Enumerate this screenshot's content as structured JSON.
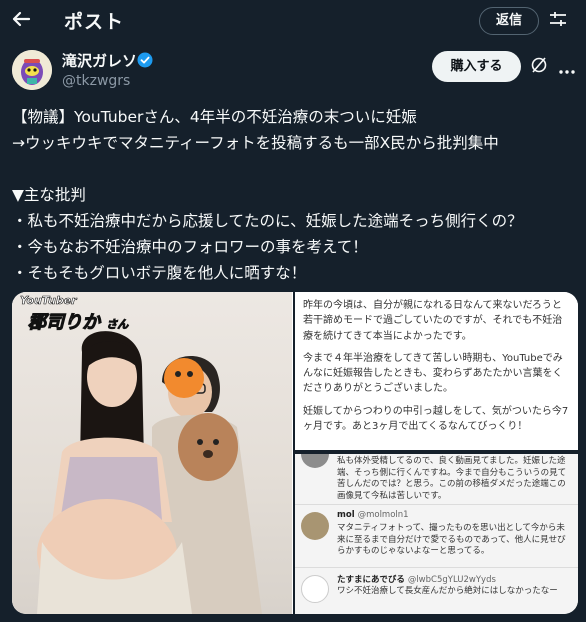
{
  "header": {
    "title": "ポスト",
    "reply_label": "返信"
  },
  "author": {
    "name": "滝沢ガレソ",
    "handle": "@tkzwgrs",
    "buy_label": "購入する"
  },
  "tweet": {
    "lines": [
      "【物議】YouTuberさん、4年半の不妊治療の末ついに妊娠",
      "→ウッキウキでマタニティーフォトを投稿するも一部X民から批判集中",
      "",
      "▼主な批判",
      "・私も不妊治療中だから応援してたのに、妊娠した途端そっち側行くの？",
      "・今もなお不妊治療中のフォロワーの事を考えて！",
      "・そもそもグロいボテ腹を他人に晒すな！"
    ]
  },
  "media": {
    "photo_label_top": "YouTuber",
    "photo_label_name": "郡司りか",
    "photo_label_san": "さん",
    "post_paragraphs": [
      "昨年の今頃は、自分が親になれる日なんて来ないだろうと若干諦めモードで過ごしていたのですが、それでも不妊治療を続けてきて本当によかったです。",
      "今まで４年半治療をしてきて苦しい時期も、YouTubeでみんなに妊娠報告したときも、変わらずあたたかい言葉をくださりありがとうございました。",
      "妊娠してからつわりの中引っ越しをして、気がついたら今7ヶ月です。あと3ヶ月で出てくるなんてびっくり！"
    ],
    "comments": [
      {
        "user": "",
        "handle": "",
        "text": "私も体外受精してるので、良く動画見てました。妊娠した途端、そっち側に行くんですね。今まで自分もこういうの見て苦しんだのでは？と思う。この前の移植ダメだった途端この画像見て今私は苦しいです。"
      },
      {
        "user": "mol",
        "handle": "@molmoln1",
        "text": "マタニティフォトって、撮ったものを思い出として今から未来に至るまで自分だけで愛でるものであって、他人に見せびらかすものじゃないよなーと思ってる。"
      },
      {
        "user": "たすまにあでびる",
        "handle": "@lwbC5gYLU2wYyds",
        "text": "ワシ不妊治療して長女産んだから絶対にはしなかったなー"
      }
    ]
  },
  "colors": {
    "background": "#15202b",
    "text": "#f7f9f9",
    "secondary": "#8b98a5",
    "verified": "#1d9bf0"
  }
}
